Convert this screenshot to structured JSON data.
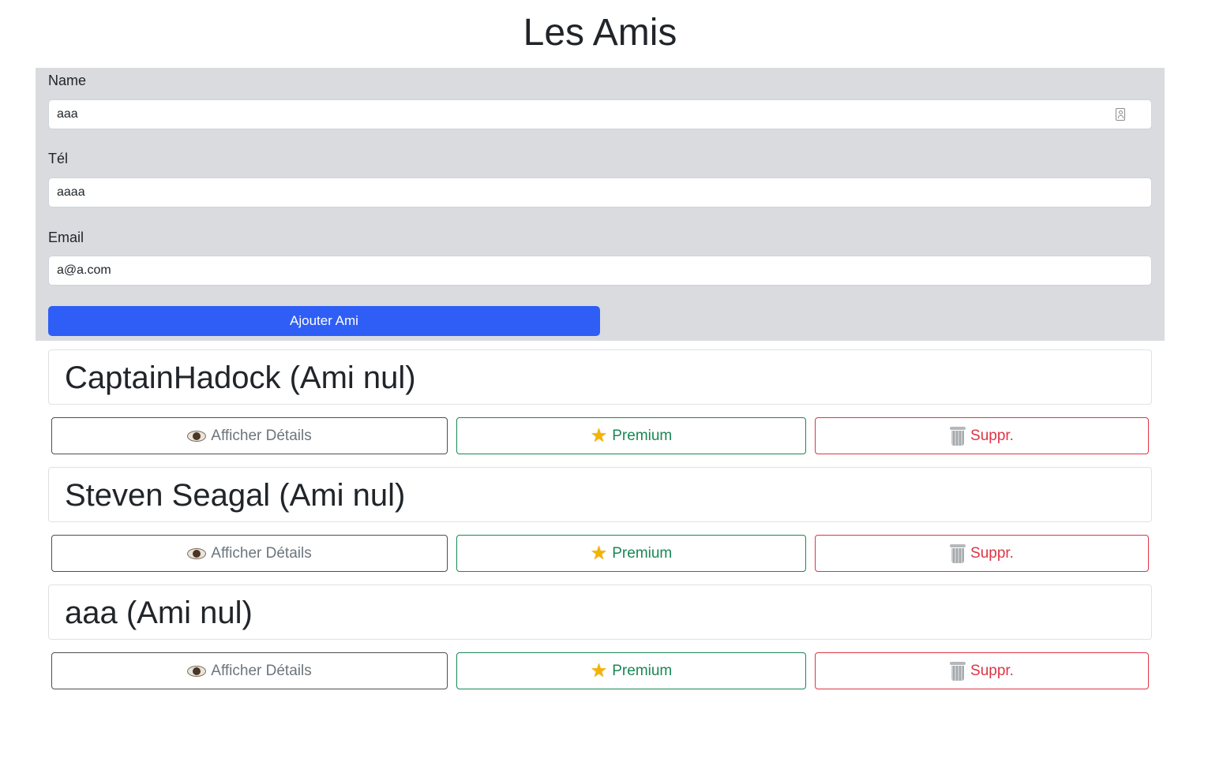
{
  "page": {
    "title": "Les Amis"
  },
  "form": {
    "name_label": "Name",
    "name_value": "aaa",
    "tel_label": "Tél",
    "tel_value": "aaaa",
    "email_label": "Email",
    "email_value": "a@a.com",
    "submit_label": "Ajouter Ami"
  },
  "friends": [
    {
      "title": "CaptainHadock (Ami nul)",
      "details_label": "Afficher Détails",
      "premium_label": "Premium",
      "delete_label": "Suppr."
    },
    {
      "title": "Steven Seagal (Ami nul)",
      "details_label": "Afficher Détails",
      "premium_label": "Premium",
      "delete_label": "Suppr."
    },
    {
      "title": "aaa (Ami nul)",
      "details_label": "Afficher Détails",
      "premium_label": "Premium",
      "delete_label": "Suppr."
    }
  ],
  "icons": {
    "details": "eye-icon",
    "premium": "star-icon",
    "delete": "trash-icon",
    "name_field": "contact-card-icon"
  },
  "colors": {
    "primary": "#2f5ef6",
    "success": "#198754",
    "danger": "#dc3545",
    "secondary": "#6c757d",
    "form_background": "#d9dbdf"
  }
}
